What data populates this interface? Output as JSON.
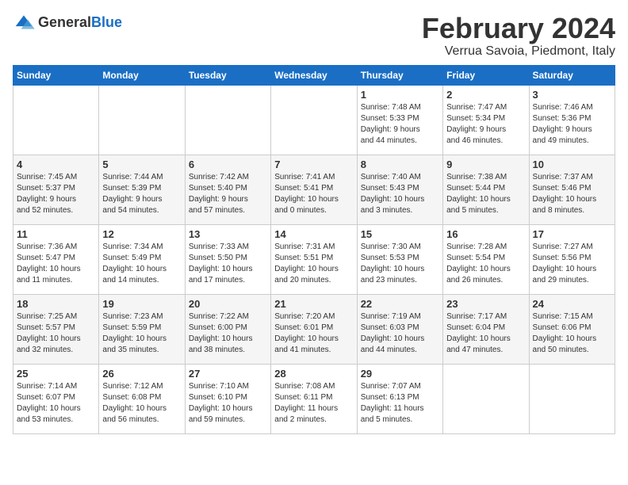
{
  "logo": {
    "general": "General",
    "blue": "Blue"
  },
  "calendar": {
    "title": "February 2024",
    "subtitle": "Verrua Savoia, Piedmont, Italy"
  },
  "weekdays": [
    "Sunday",
    "Monday",
    "Tuesday",
    "Wednesday",
    "Thursday",
    "Friday",
    "Saturday"
  ],
  "weeks": [
    [
      {
        "day": "",
        "info": ""
      },
      {
        "day": "",
        "info": ""
      },
      {
        "day": "",
        "info": ""
      },
      {
        "day": "",
        "info": ""
      },
      {
        "day": "1",
        "info": "Sunrise: 7:48 AM\nSunset: 5:33 PM\nDaylight: 9 hours\nand 44 minutes."
      },
      {
        "day": "2",
        "info": "Sunrise: 7:47 AM\nSunset: 5:34 PM\nDaylight: 9 hours\nand 46 minutes."
      },
      {
        "day": "3",
        "info": "Sunrise: 7:46 AM\nSunset: 5:36 PM\nDaylight: 9 hours\nand 49 minutes."
      }
    ],
    [
      {
        "day": "4",
        "info": "Sunrise: 7:45 AM\nSunset: 5:37 PM\nDaylight: 9 hours\nand 52 minutes."
      },
      {
        "day": "5",
        "info": "Sunrise: 7:44 AM\nSunset: 5:39 PM\nDaylight: 9 hours\nand 54 minutes."
      },
      {
        "day": "6",
        "info": "Sunrise: 7:42 AM\nSunset: 5:40 PM\nDaylight: 9 hours\nand 57 minutes."
      },
      {
        "day": "7",
        "info": "Sunrise: 7:41 AM\nSunset: 5:41 PM\nDaylight: 10 hours\nand 0 minutes."
      },
      {
        "day": "8",
        "info": "Sunrise: 7:40 AM\nSunset: 5:43 PM\nDaylight: 10 hours\nand 3 minutes."
      },
      {
        "day": "9",
        "info": "Sunrise: 7:38 AM\nSunset: 5:44 PM\nDaylight: 10 hours\nand 5 minutes."
      },
      {
        "day": "10",
        "info": "Sunrise: 7:37 AM\nSunset: 5:46 PM\nDaylight: 10 hours\nand 8 minutes."
      }
    ],
    [
      {
        "day": "11",
        "info": "Sunrise: 7:36 AM\nSunset: 5:47 PM\nDaylight: 10 hours\nand 11 minutes."
      },
      {
        "day": "12",
        "info": "Sunrise: 7:34 AM\nSunset: 5:49 PM\nDaylight: 10 hours\nand 14 minutes."
      },
      {
        "day": "13",
        "info": "Sunrise: 7:33 AM\nSunset: 5:50 PM\nDaylight: 10 hours\nand 17 minutes."
      },
      {
        "day": "14",
        "info": "Sunrise: 7:31 AM\nSunset: 5:51 PM\nDaylight: 10 hours\nand 20 minutes."
      },
      {
        "day": "15",
        "info": "Sunrise: 7:30 AM\nSunset: 5:53 PM\nDaylight: 10 hours\nand 23 minutes."
      },
      {
        "day": "16",
        "info": "Sunrise: 7:28 AM\nSunset: 5:54 PM\nDaylight: 10 hours\nand 26 minutes."
      },
      {
        "day": "17",
        "info": "Sunrise: 7:27 AM\nSunset: 5:56 PM\nDaylight: 10 hours\nand 29 minutes."
      }
    ],
    [
      {
        "day": "18",
        "info": "Sunrise: 7:25 AM\nSunset: 5:57 PM\nDaylight: 10 hours\nand 32 minutes."
      },
      {
        "day": "19",
        "info": "Sunrise: 7:23 AM\nSunset: 5:59 PM\nDaylight: 10 hours\nand 35 minutes."
      },
      {
        "day": "20",
        "info": "Sunrise: 7:22 AM\nSunset: 6:00 PM\nDaylight: 10 hours\nand 38 minutes."
      },
      {
        "day": "21",
        "info": "Sunrise: 7:20 AM\nSunset: 6:01 PM\nDaylight: 10 hours\nand 41 minutes."
      },
      {
        "day": "22",
        "info": "Sunrise: 7:19 AM\nSunset: 6:03 PM\nDaylight: 10 hours\nand 44 minutes."
      },
      {
        "day": "23",
        "info": "Sunrise: 7:17 AM\nSunset: 6:04 PM\nDaylight: 10 hours\nand 47 minutes."
      },
      {
        "day": "24",
        "info": "Sunrise: 7:15 AM\nSunset: 6:06 PM\nDaylight: 10 hours\nand 50 minutes."
      }
    ],
    [
      {
        "day": "25",
        "info": "Sunrise: 7:14 AM\nSunset: 6:07 PM\nDaylight: 10 hours\nand 53 minutes."
      },
      {
        "day": "26",
        "info": "Sunrise: 7:12 AM\nSunset: 6:08 PM\nDaylight: 10 hours\nand 56 minutes."
      },
      {
        "day": "27",
        "info": "Sunrise: 7:10 AM\nSunset: 6:10 PM\nDaylight: 10 hours\nand 59 minutes."
      },
      {
        "day": "28",
        "info": "Sunrise: 7:08 AM\nSunset: 6:11 PM\nDaylight: 11 hours\nand 2 minutes."
      },
      {
        "day": "29",
        "info": "Sunrise: 7:07 AM\nSunset: 6:13 PM\nDaylight: 11 hours\nand 5 minutes."
      },
      {
        "day": "",
        "info": ""
      },
      {
        "day": "",
        "info": ""
      }
    ]
  ]
}
